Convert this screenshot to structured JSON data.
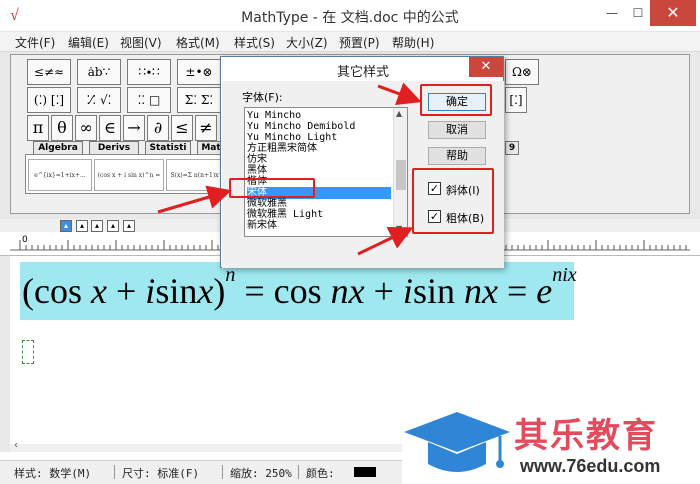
{
  "window": {
    "title": "MathType - 在 文档.doc 中的公式",
    "minimize": "—",
    "maximize": "☐",
    "close": "✕",
    "app_icon": "√"
  },
  "menu": {
    "file": "文件(F)",
    "edit": "编辑(E)",
    "view": "视图(V)",
    "format": "格式(M)",
    "style": "样式(S)",
    "size": "大小(Z)",
    "preset": "预置(P)",
    "help": "帮助(H)"
  },
  "toolbar": {
    "row1": [
      "≤≠≈",
      "ȧb∵",
      "∷∙∷",
      "±•⊗",
      "Ω⊗"
    ],
    "row2": [
      "(⁚) [⁚]",
      "⁚⁄⁚ √⁚",
      "⁚⁚ □",
      "Σ⁚ Σ⁚",
      "[⁚]"
    ],
    "row3": [
      "π",
      "θ",
      "∞",
      "∈",
      "→",
      "∂",
      "≤",
      "≠"
    ],
    "tabs": [
      "Algebra",
      "Derivs",
      "Statisti",
      "Mat",
      "9"
    ],
    "templates": [
      "e^{ix}=1+ix+...",
      "(cos x + i sin x)^n = cos",
      "S(x)=Σ n(n+1)x^n"
    ]
  },
  "ruler": {
    "zero_label": "0"
  },
  "formula": {
    "open": "(",
    "cos": "cos",
    "x1": "x",
    "plus": " + ",
    "i1": "i",
    "sin": "sin",
    "x2": "x",
    "close": ")",
    "n_exp": "n",
    "eq1": " = ",
    "cos2": "cos",
    "nx1": "nx",
    "plus2": " + ",
    "i2": "i",
    "sin2": "sin",
    "nx2": "nx",
    "eq2": " = ",
    "e": "e",
    "nix_exp": "nix"
  },
  "statusbar": {
    "style": "样式: 数学(M)",
    "size": "尺寸: 标准(F)",
    "zoom": "缩放: 250%",
    "color": "颜色:"
  },
  "dialog": {
    "title": "其它样式",
    "close": "✕",
    "font_label": "字体(F):",
    "fonts": [
      "Yu Mincho",
      "Yu Mincho Demibold",
      "Yu Mincho Light",
      "方正粗黑宋简体",
      "仿宋",
      "黑体",
      "楷体",
      "宋体",
      "微软雅黑",
      "微软雅黑 Light",
      "新宋体"
    ],
    "selected_font": "宋体",
    "ok": "确定",
    "cancel": "取消",
    "help": "帮助",
    "italic": "斜体(I)",
    "italic_checked": "✓",
    "bold": "粗体(B)",
    "bold_checked": "✓"
  },
  "watermark": {
    "brand": "其乐教育",
    "url": "www.76edu.com"
  },
  "colors": {
    "annotation_red": "#e02020",
    "formula_highlight": "#9fe8f0",
    "selection_blue": "#3399ff",
    "close_red": "#c9473d",
    "watermark_blue": "#2f86d6",
    "watermark_pink": "#e34b5c"
  }
}
